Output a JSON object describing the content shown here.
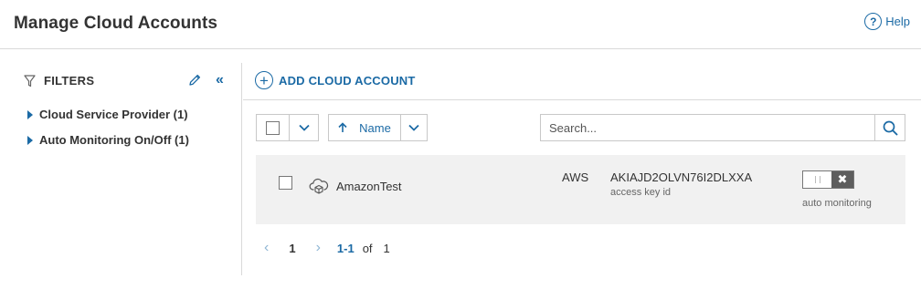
{
  "header": {
    "title": "Manage Cloud Accounts",
    "help_icon_glyph": "?",
    "help_label": "Help"
  },
  "sidebar": {
    "filters_label": "FILTERS",
    "icons": {
      "filter": "filter-icon",
      "edit": "pencil-icon",
      "collapse": "double-chevron-left-icon"
    },
    "items": [
      {
        "label": "Cloud Service Provider (1)"
      },
      {
        "label": "Auto Monitoring On/Off (1)"
      }
    ]
  },
  "actions": {
    "add_label": "ADD CLOUD ACCOUNT",
    "add_icon_glyph": "+"
  },
  "toolbar": {
    "sort_label": "Name",
    "search_placeholder": "Search..."
  },
  "accounts": [
    {
      "name": "AmazonTest",
      "provider": "AWS",
      "access_key": "AKIAJD2OLVN76I2DLXXA",
      "access_key_label": "access key id",
      "auto_monitoring_on": false,
      "auto_monitoring_label": "auto monitoring",
      "toggle_off_glyph": "✖"
    }
  ],
  "pagination": {
    "current_page": "1",
    "range": "1-1",
    "of_label": "of",
    "total": "1"
  },
  "colors": {
    "accent": "#1b6aa5",
    "row_bg": "#f1f1f1",
    "toggle_off": "#5e5e5e",
    "border": "#c8c8c8"
  }
}
